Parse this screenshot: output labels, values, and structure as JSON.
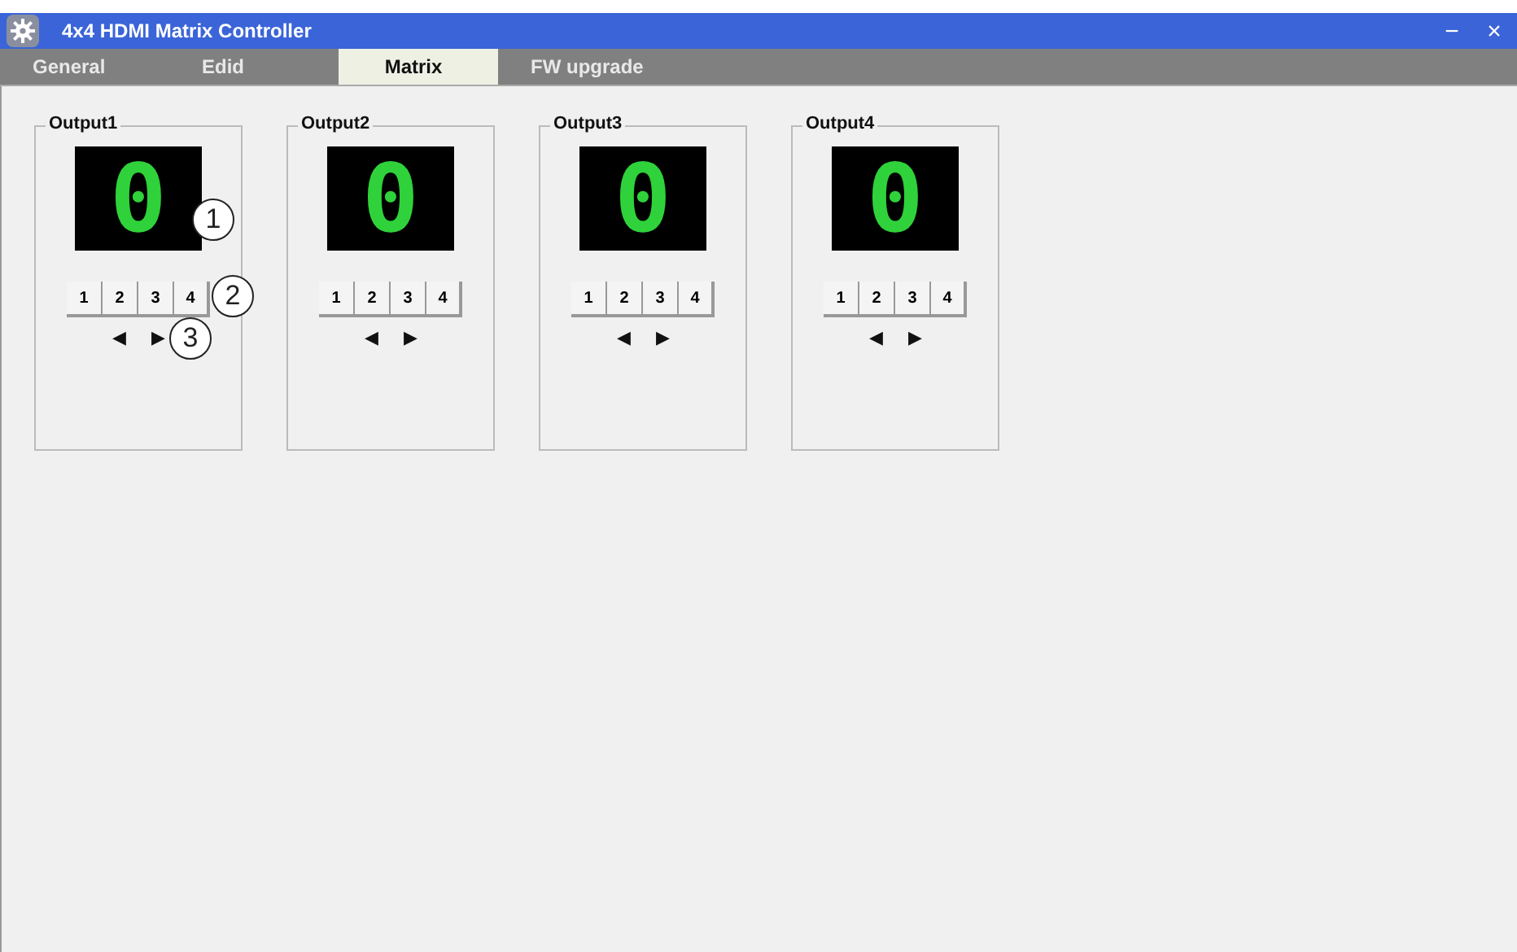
{
  "window": {
    "title": "4x4 HDMI Matrix Controller",
    "controls": [
      "−",
      "×"
    ]
  },
  "tabs": [
    {
      "label": "General",
      "selected": false
    },
    {
      "label": "Edid",
      "selected": false
    },
    {
      "label": "Matrix",
      "selected": true
    },
    {
      "label": "FW upgrade",
      "selected": false
    }
  ],
  "outputs": [
    {
      "title": "Output1",
      "display": "0",
      "inputs": [
        "1",
        "2",
        "3",
        "4"
      ],
      "prev": "◀",
      "next": "▶",
      "callouts": {
        "display": "1",
        "inputs": "2",
        "arrows": "3"
      }
    },
    {
      "title": "Output2",
      "display": "0",
      "inputs": [
        "1",
        "2",
        "3",
        "4"
      ],
      "prev": "◀",
      "next": "▶"
    },
    {
      "title": "Output3",
      "display": "0",
      "inputs": [
        "1",
        "2",
        "3",
        "4"
      ],
      "prev": "◀",
      "next": "▶"
    },
    {
      "title": "Output4",
      "display": "0",
      "inputs": [
        "1",
        "2",
        "3",
        "4"
      ],
      "prev": "◀",
      "next": "▶"
    }
  ]
}
